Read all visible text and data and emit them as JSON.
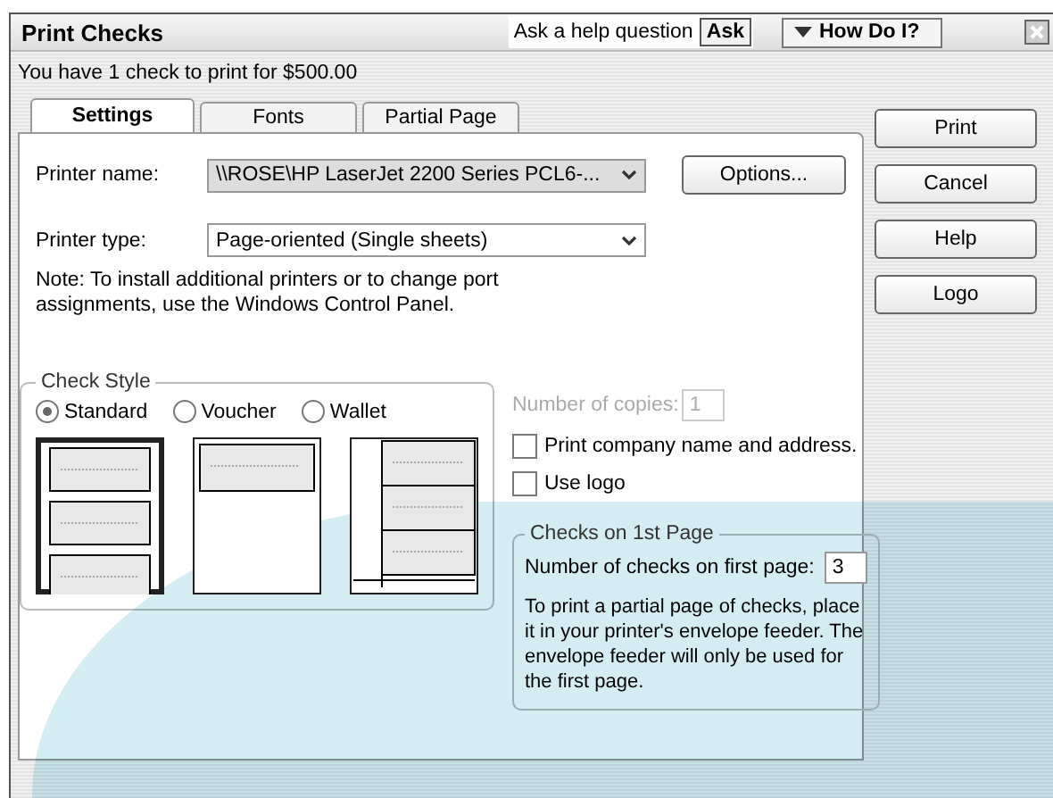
{
  "window": {
    "title": "Print Checks",
    "help_field": {
      "placeholder": "Ask a help question"
    },
    "ask_button": "Ask",
    "how_do_i_button": "How Do I?"
  },
  "summary": "You have 1 check to print for $500.00",
  "tabs": [
    {
      "label": "Settings",
      "selected": true
    },
    {
      "label": "Fonts",
      "selected": false
    },
    {
      "label": "Partial Page",
      "selected": false
    }
  ],
  "printer_name": {
    "label": "Printer name:",
    "value": "\\\\ROSE\\HP LaserJet 2200 Series PCL6-..."
  },
  "options_button": "Options...",
  "printer_type": {
    "label": "Printer type:",
    "value": "Page-oriented (Single sheets)"
  },
  "note": "Note: To install additional printers or to change port assignments, use the Windows Control Panel.",
  "check_style": {
    "title": "Check Style",
    "options": [
      {
        "label": "Standard",
        "kind": "standard",
        "selected": true
      },
      {
        "label": "Voucher",
        "kind": "voucher",
        "selected": false
      },
      {
        "label": "Wallet",
        "kind": "wallet",
        "selected": false
      }
    ]
  },
  "copies": {
    "label": "Number of copies:",
    "value": "1",
    "disabled": true
  },
  "checkboxes": [
    {
      "label": "Print company name and address.",
      "checked": false
    },
    {
      "label": "Use logo",
      "checked": false
    }
  ],
  "first_page": {
    "title": "Checks on 1st Page",
    "label": "Number of checks on first page:",
    "value": "3",
    "text": "To print a partial page of checks, place it in your printer's envelope feeder. The envelope feeder will only be used for the first page."
  },
  "buttons": [
    "Print",
    "Cancel",
    "Help",
    "Logo"
  ]
}
